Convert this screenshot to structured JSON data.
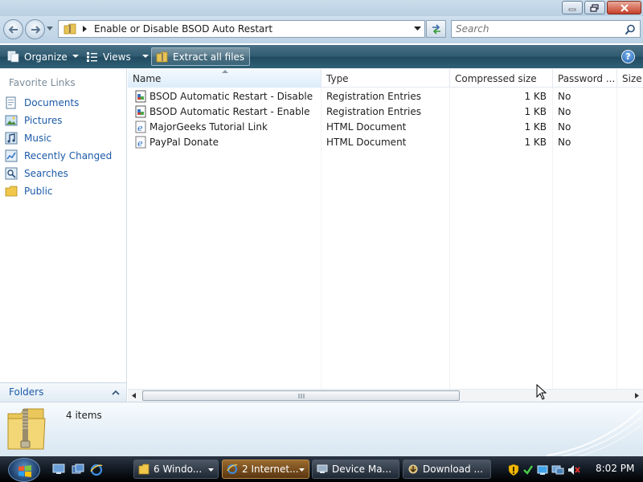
{
  "window": {
    "controls": {
      "minimize": "minimize-icon",
      "maximize": "maximize-icon",
      "close": "close-icon"
    }
  },
  "address": {
    "path": "Enable or Disable BSOD Auto Restart",
    "search_placeholder": "Search"
  },
  "toolbar": {
    "organize": "Organize",
    "views": "Views",
    "extract": "Extract all files",
    "help": "?"
  },
  "navigation": {
    "heading": "Favorite Links",
    "links": [
      {
        "label": "Documents",
        "icon": "documents-icon"
      },
      {
        "label": "Pictures",
        "icon": "pictures-icon"
      },
      {
        "label": "Music",
        "icon": "music-icon"
      },
      {
        "label": "Recently Changed",
        "icon": "recently-changed-icon"
      },
      {
        "label": "Searches",
        "icon": "searches-icon"
      },
      {
        "label": "Public",
        "icon": "public-folder-icon"
      }
    ],
    "folders_label": "Folders"
  },
  "file_list": {
    "columns": [
      "Name",
      "Type",
      "Compressed size",
      "Password ...",
      "Size"
    ],
    "rows": [
      {
        "name": "BSOD Automatic Restart - Disable",
        "type": "Registration Entries",
        "compressed_size": "1 KB",
        "password": "No",
        "icon": "registry-file-icon"
      },
      {
        "name": "BSOD Automatic Restart - Enable",
        "type": "Registration Entries",
        "compressed_size": "1 KB",
        "password": "No",
        "icon": "registry-file-icon"
      },
      {
        "name": "MajorGeeks Tutorial Link",
        "type": "HTML Document",
        "compressed_size": "1 KB",
        "password": "No",
        "icon": "html-document-icon"
      },
      {
        "name": "PayPal Donate",
        "type": "HTML Document",
        "compressed_size": "1 KB",
        "password": "No",
        "icon": "html-document-icon"
      }
    ]
  },
  "details": {
    "item_count": "4 items"
  },
  "taskbar": {
    "tasks": [
      {
        "label": "6 Windo...",
        "icon": "folder-icon",
        "active": false
      },
      {
        "label": "2 Internet...",
        "icon": "internet-explorer-icon",
        "active": true
      },
      {
        "label": "Device Ma...",
        "icon": "device-manager-icon",
        "active": false
      },
      {
        "label": "Download ...",
        "icon": "download-icon",
        "active": false
      }
    ],
    "clock": "8:02 PM"
  },
  "colors": {
    "link": "#1c5aa8",
    "command_bar": "#2f5a70",
    "taskbar": "#111923"
  }
}
